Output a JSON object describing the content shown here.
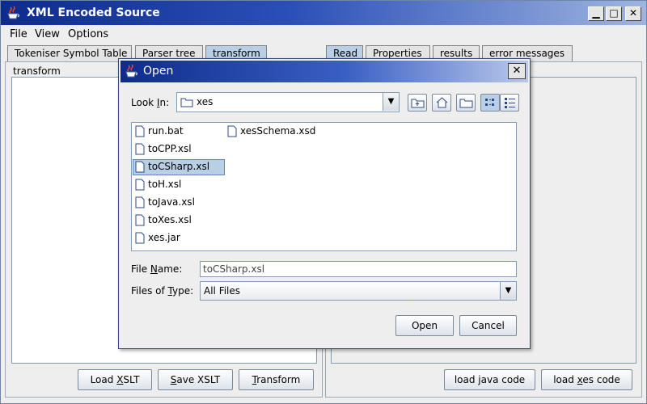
{
  "window": {
    "title": "XML Encoded Source"
  },
  "menu": [
    "File",
    "View",
    "Options"
  ],
  "left_tabs": [
    {
      "label": "Tokeniser Symbol Table",
      "selected": false
    },
    {
      "label": "Parser tree",
      "selected": false
    },
    {
      "label": "transform",
      "selected": true
    }
  ],
  "right_tabs": [
    {
      "label": "Read",
      "selected": true
    },
    {
      "label": "Properties",
      "selected": false
    },
    {
      "label": "results",
      "selected": false
    },
    {
      "label": "error messages",
      "selected": false
    }
  ],
  "left_panel": {
    "label": "transform"
  },
  "left_buttons": {
    "load_xslt": {
      "pre": "Load ",
      "mn": "X",
      "post": "SLT"
    },
    "save_xslt": {
      "pre": "",
      "mn": "S",
      "post": "ave XSLT"
    },
    "transform": {
      "pre": "",
      "mn": "T",
      "post": "ransform"
    }
  },
  "right_buttons": {
    "load_java": {
      "pre": "load ",
      "mn": "j",
      "post": "ava code"
    },
    "load_xes": {
      "pre": "load ",
      "mn": "x",
      "post": "es code"
    }
  },
  "dialog": {
    "title": "Open",
    "look_in": {
      "pre": "Look ",
      "mn": "I",
      "post": "n:"
    },
    "look_in_value": "xes",
    "files": [
      "run.bat",
      "toCPP.xsl",
      "toCSharp.xsl",
      "toH.xsl",
      "toJava.xsl",
      "toXes.xsl",
      "xes.jar",
      "xesSchema.xsd"
    ],
    "selected_file": "toCSharp.xsl",
    "file_name": {
      "pre": "File ",
      "mn": "N",
      "post": "ame:"
    },
    "file_name_value": "toCSharp.xsl",
    "files_of_type": {
      "pre": "Files of ",
      "mn": "T",
      "post": "ype:"
    },
    "files_of_type_value": "All Files",
    "open_label": "Open",
    "cancel_label": "Cancel"
  },
  "colors": {
    "title_gradient_start": "#0e2b8c",
    "selection": "#b8cfe5",
    "window_bg": "#eeeeee"
  }
}
